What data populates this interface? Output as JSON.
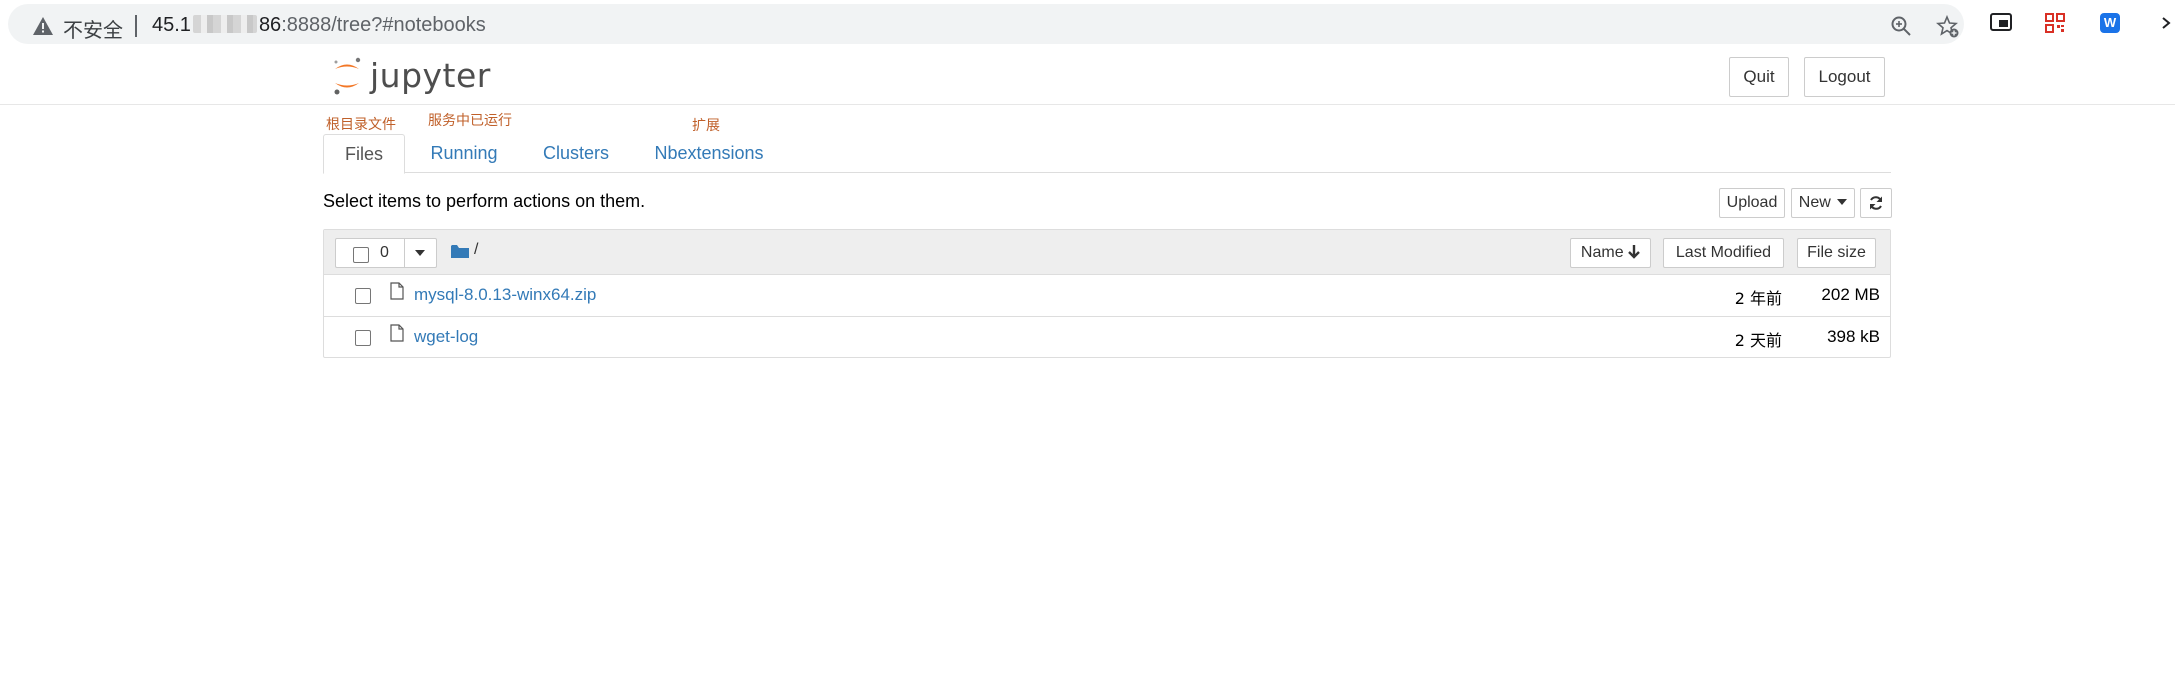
{
  "browser": {
    "security_label": "不安全",
    "url_host_start": "45.1",
    "url_host_end": "86",
    "url_path": ":8888/tree?#notebooks"
  },
  "header": {
    "logo_text": "jupyter",
    "quit_label": "Quit",
    "logout_label": "Logout"
  },
  "annotations": {
    "files": "根目录文件",
    "running": "服务中已运行",
    "nbextensions": "扩展"
  },
  "tabs": [
    {
      "label": "Files",
      "active": true
    },
    {
      "label": "Running",
      "active": false
    },
    {
      "label": "Clusters",
      "active": false
    },
    {
      "label": "Nbextensions",
      "active": false
    }
  ],
  "toolbar": {
    "instructions": "Select items to perform actions on them.",
    "upload_label": "Upload",
    "new_label": "New"
  },
  "list": {
    "selected_count": "0",
    "breadcrumb": "/",
    "columns": {
      "name": "Name",
      "last_modified": "Last Modified",
      "file_size": "File size"
    },
    "files": [
      {
        "name": "mysql-8.0.13-winx64.zip",
        "modified": "2 年前",
        "size": "202 MB"
      },
      {
        "name": "wget-log",
        "modified": "2 天前",
        "size": "398 kB"
      }
    ]
  },
  "colors": {
    "link": "#337ab7",
    "annotation": "#c0602a",
    "jupyter_orange": "#f37726"
  }
}
